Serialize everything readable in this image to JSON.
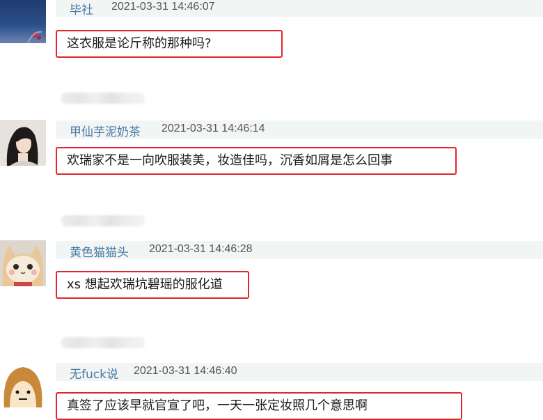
{
  "comments": [
    {
      "username": "毕社",
      "timestamp": "2021-03-31 14:46:07",
      "text": "这衣服是论斤称的那种吗?"
    },
    {
      "username": "甲仙芋泥奶茶",
      "timestamp": "2021-03-31 14:46:14",
      "text": "欢瑞家不是一向吹服装美，妆造佳吗，沉香如屑是怎么回事"
    },
    {
      "username": "黄色猫猫头",
      "timestamp": "2021-03-31 14:46:28",
      "text": "xs 想起欢瑞坑碧瑶的服化道"
    },
    {
      "username": "无fuck说",
      "timestamp": "2021-03-31 14:46:40",
      "text": "真签了应该早就官宣了吧，一天一张定妆照几个意思啊"
    }
  ]
}
